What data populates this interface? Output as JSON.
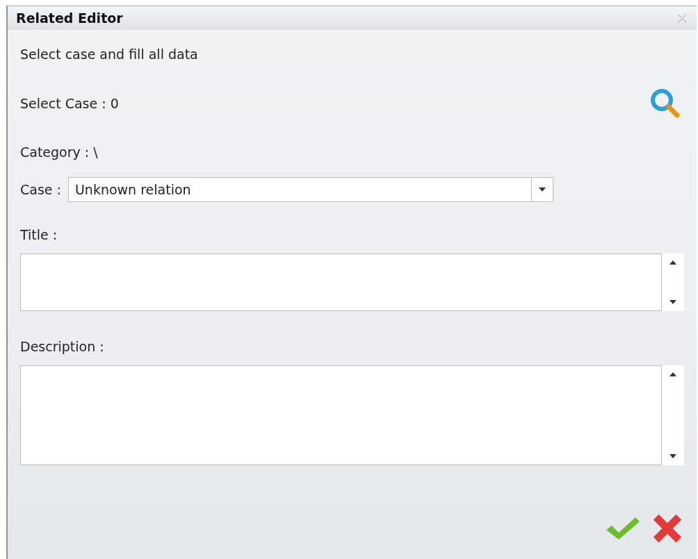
{
  "window": {
    "title": "Related Editor",
    "close": "⤫"
  },
  "intro": "Select case and fill all data",
  "select_case": "Select Case : 0",
  "category": "Category : \\",
  "case": {
    "label": "Case :",
    "value": "Unknown relation"
  },
  "fields": [
    {
      "label": "Title :",
      "kind": "short"
    },
    {
      "label": "Description :",
      "kind": "tall"
    }
  ]
}
